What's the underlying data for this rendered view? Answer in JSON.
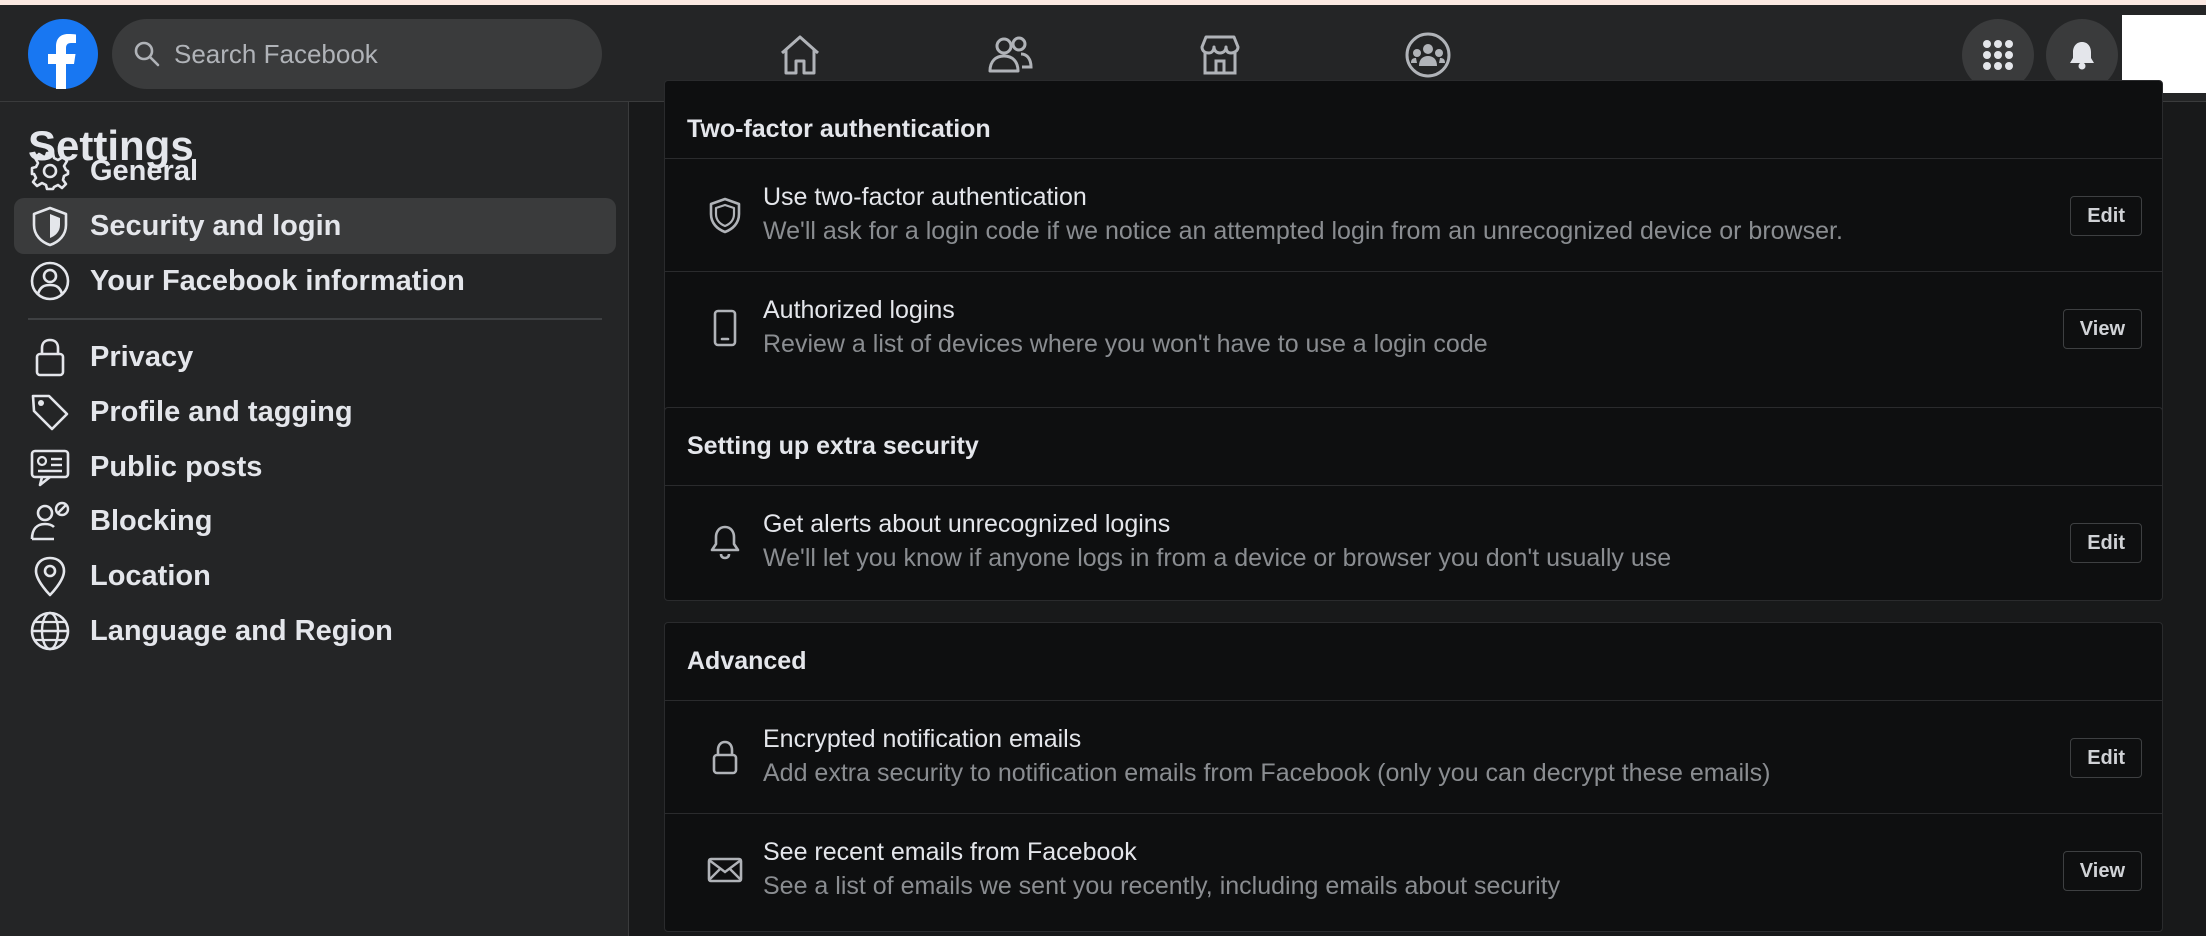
{
  "header": {
    "search_placeholder": "Search Facebook",
    "nav_icons": [
      "home-icon",
      "friends-icon",
      "marketplace-icon",
      "groups-icon"
    ],
    "right_icons": [
      "menu-grid-icon",
      "notifications-bell-icon"
    ],
    "brand_color": "#1877f2"
  },
  "sidebar": {
    "title": "Settings",
    "items": [
      {
        "label": "General",
        "icon": "gear-icon"
      },
      {
        "label": "Security and login",
        "icon": "shield-icon",
        "active": true
      },
      {
        "label": "Your Facebook information",
        "icon": "user-circle-icon"
      },
      {
        "label": "Privacy",
        "icon": "lock-icon"
      },
      {
        "label": "Profile and tagging",
        "icon": "tag-icon"
      },
      {
        "label": "Public posts",
        "icon": "public-posts-icon"
      },
      {
        "label": "Blocking",
        "icon": "blocking-icon"
      },
      {
        "label": "Location",
        "icon": "location-pin-icon"
      },
      {
        "label": "Language and Region",
        "icon": "globe-icon"
      }
    ]
  },
  "sections": [
    {
      "heading": "Two-factor authentication",
      "rows": [
        {
          "title": "Use two-factor authentication",
          "desc": "We'll ask for a login code if we notice an attempted login from an unrecognized device or browser.",
          "button": "Edit",
          "icon": "shield-icon"
        },
        {
          "title": "Authorized logins",
          "desc": "Review a list of devices where you won't have to use a login code",
          "button": "View",
          "icon": "phone-icon"
        }
      ]
    },
    {
      "heading": "Setting up extra security",
      "rows": [
        {
          "title": "Get alerts about unrecognized logins",
          "desc": "We'll let you know if anyone logs in from a device or browser you don't usually use",
          "button": "Edit",
          "icon": "bell-icon"
        }
      ]
    },
    {
      "heading": "Advanced",
      "rows": [
        {
          "title": "Encrypted notification emails",
          "desc": "Add extra security to notification emails from Facebook (only you can decrypt these emails)",
          "button": "Edit",
          "icon": "lock-icon"
        },
        {
          "title": "See recent emails from Facebook",
          "desc": "See a list of emails we sent you recently, including emails about security",
          "button": "View",
          "icon": "envelope-icon"
        }
      ]
    }
  ]
}
